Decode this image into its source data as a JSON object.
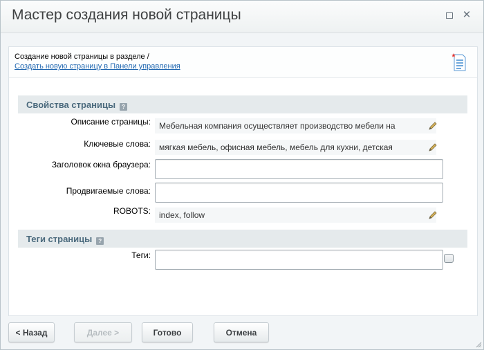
{
  "dialog": {
    "title": "Мастер создания новой страницы"
  },
  "info": {
    "text": "Создание новой страницы в разделе /",
    "link": "Создать новую страницу в Панели управления"
  },
  "properties": {
    "header": "Свойства страницы",
    "description_label": "Описание страницы:",
    "description_value": "Мебельная компания осуществляет производство мебели на",
    "keywords_label": "Ключевые слова:",
    "keywords_value": "мягкая мебель, офисная мебель, мебель для кухни, детская",
    "browser_title_label": "Заголовок окна браузера:",
    "browser_title_value": "",
    "promoted_words_label": "Продвигаемые слова:",
    "promoted_words_value": "",
    "robots_label": "ROBOTS:",
    "robots_value": "index, follow"
  },
  "tags": {
    "header": "Теги страницы",
    "tags_label": "Теги:",
    "tags_value": ""
  },
  "footer": {
    "back_label": "< Назад",
    "next_label": "Далее >",
    "done_label": "Готово",
    "cancel_label": "Отмена"
  },
  "colors": {
    "link": "#2067b0",
    "section_header_bg": "#e5eaec",
    "section_header_text": "#4b6a7d"
  }
}
